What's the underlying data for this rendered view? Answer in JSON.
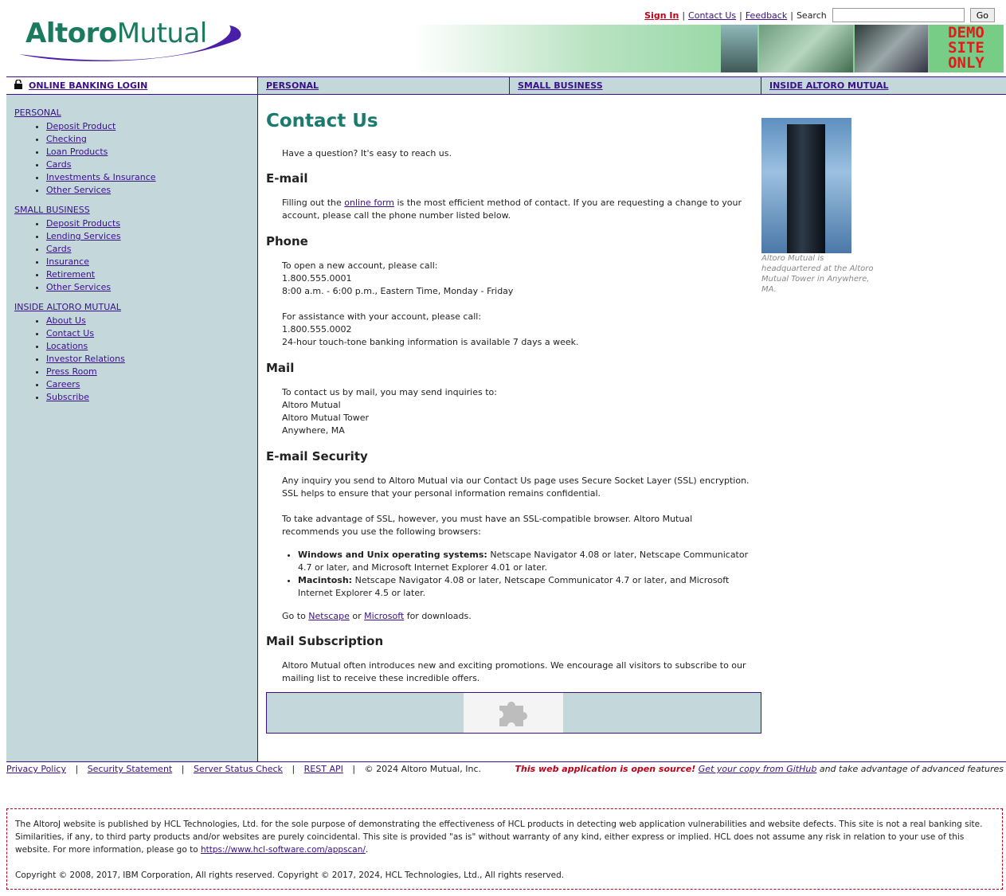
{
  "brand": {
    "logo_bold": "Altoro",
    "logo_regular": "Mutual",
    "accent": "#1a7a5e",
    "swoosh_color": "#4b1ea8"
  },
  "top_links": {
    "sign_in": "Sign In",
    "contact_us": "Contact Us",
    "feedback": "Feedback",
    "search_label": "Search",
    "search_value": "",
    "go": "Go",
    "sep": "|"
  },
  "banner": {
    "demo_lines": [
      "DEMO",
      "SITE",
      "ONLY"
    ]
  },
  "nav": {
    "login": "ONLINE BANKING LOGIN",
    "personal": "PERSONAL",
    "small_business": "SMALL BUSINESS",
    "inside": "INSIDE ALTORO MUTUAL"
  },
  "sidebar": {
    "personal_title": "PERSONAL",
    "personal_items": [
      "Deposit Product",
      "Checking",
      "Loan Products",
      "Cards",
      "Investments & Insurance",
      "Other Services"
    ],
    "small_title": "SMALL BUSINESS",
    "small_items": [
      "Deposit Products",
      "Lending Services",
      "Cards",
      "Insurance",
      "Retirement",
      "Other Services"
    ],
    "inside_title": "INSIDE ALTORO MUTUAL",
    "inside_items": [
      "About Us",
      "Contact Us",
      "Locations",
      "Investor Relations",
      "Press Room",
      "Careers",
      "Subscribe"
    ]
  },
  "main": {
    "title": "Contact Us",
    "intro": "Have a question? It's easy to reach us.",
    "email_heading": "E-mail",
    "email_pre": "Filling out the ",
    "email_link": "online form",
    "email_post": " is the most efficient method of contact. If you are requesting a change to your account, please call the phone number listed below.",
    "phone_heading": "Phone",
    "phone_new_1": "To open a new account, please call:",
    "phone_new_2": "1.800.555.0001",
    "phone_new_3": "8:00 a.m. - 6:00 p.m., Eastern Time, Monday - Friday",
    "phone_assist_1": "For assistance with your account, please call:",
    "phone_assist_2": "1.800.555.0002",
    "phone_assist_3": "24-hour touch-tone banking information is available 7 days a week.",
    "mail_heading": "Mail",
    "mail_1": "To contact us by mail, you may send inquiries to:",
    "mail_2": "Altoro Mutual",
    "mail_3": "Altoro Mutual Tower",
    "mail_4": "Anywhere, MA",
    "security_heading": "E-mail Security",
    "security_p1": "Any inquiry you send to Altoro Mutual via our Contact Us page uses Secure Socket Layer (SSL) encryption. SSL helps to ensure that your personal information remains confidential.",
    "security_p2": "To take advantage of SSL, however, you must have an SSL-compatible browser. Altoro Mutual recommends you use the following browsers:",
    "browser_1_label": "Windows and Unix operating systems:",
    "browser_1_text": " Netscape Navigator 4.08 or later, Netscape Communicator 4.7 or later, and Microsoft Internet Explorer 4.01 or later.",
    "browser_2_label": "Macintosh:",
    "browser_2_text": " Netscape Navigator 4.08 or later, Netscape Communicator 4.7 or later, and Microsoft Internet Explorer 4.5 or later.",
    "goto_pre": "Go to ",
    "netscape": "Netscape",
    "goto_or": " or ",
    "microsoft": "Microsoft",
    "goto_post": " for downloads.",
    "sub_heading": "Mail Subscription",
    "sub_text": "Altoro Mutual often introduces new and exciting promotions. We encourage all visitors to subscribe to our mailing list to receive these incredible offers.",
    "caption": "Altoro Mutual is headquartered at the Altoro Mutual Tower in Anywhere, MA."
  },
  "footer": {
    "privacy": "Privacy Policy",
    "security": "Security Statement",
    "server": "Server Status Check",
    "rest": "REST API",
    "copy": "© 2024 Altoro Mutual, Inc.",
    "sep": "|",
    "os_text": "This web application is open source!",
    "github": "Get your copy from GitHub",
    "os_post": " and take advantage of advanced features"
  },
  "disclaimer": {
    "text_pre": "The AltoroJ website is published by HCL Technologies, Ltd. for the sole purpose of demonstrating the effectiveness of HCL products in detecting web application vulnerabilities and website defects. This site is not a real banking site. Similarities, if any, to third party products and/or websites are purely coincidental. This site is provided \"as is\" without warranty of any kind, either express or implied. HCL does not assume any risk in relation to your use of this website. For more information, please go to ",
    "link": "https://www.hcl-software.com/appscan/",
    "text_post": ".",
    "copyright": "Copyright © 2008, 2017, IBM Corporation, All rights reserved. Copyright © 2017, 2024, HCL Technologies, Ltd., All rights reserved."
  }
}
